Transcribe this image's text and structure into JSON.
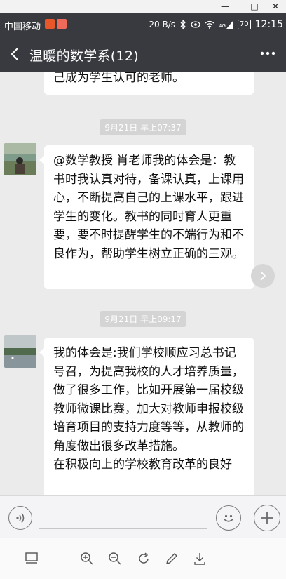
{
  "window": {
    "minimize": "—",
    "maximize": "□",
    "close": "✕"
  },
  "statusbar": {
    "carrier": "中国移动",
    "speed": "20 B/s",
    "signal_label": "4G",
    "battery": "70",
    "time": "12:15"
  },
  "header": {
    "title": "温暖的数学系(12)",
    "more_glyph": "•••"
  },
  "messages": [
    {
      "text": "己成为学生认可的老师。"
    },
    {
      "time": "9月21日 早上07:37",
      "text": "@数学教授  肖老师我的体会是：教书时我认真对待，备课认真，上课用心，不断提高自己的上课水平，跟进学生的变化。教书的同时育人更重要，要不时提醒学生的不端行为和不良作为，帮助学生树立正确的三观。"
    },
    {
      "time": "9月21日 早上09:17",
      "text": "我的体会是:我们学校顺应习总书记号召，为提高我校的人才培养质量，做了很多工作，比如开展第一届校级教师微课比赛，加大对教师申报校级培育项目的支持力度等等，从教师的角度做出很多改革措施。\n在积极向上的学校教育改革的良好"
    }
  ],
  "colors": {
    "header_bg": "#393a3f",
    "chat_bg": "#ebebeb",
    "bubble_bg": "#ffffff",
    "time_badge_bg": "#d4d4d4"
  },
  "icons": {
    "input": [
      "voice-icon",
      "emoji-icon",
      "add-icon"
    ],
    "toolbar": [
      "panel-icon",
      "zoom-in-icon",
      "zoom-out-icon",
      "rotate-icon",
      "edit-icon",
      "download-icon"
    ]
  }
}
